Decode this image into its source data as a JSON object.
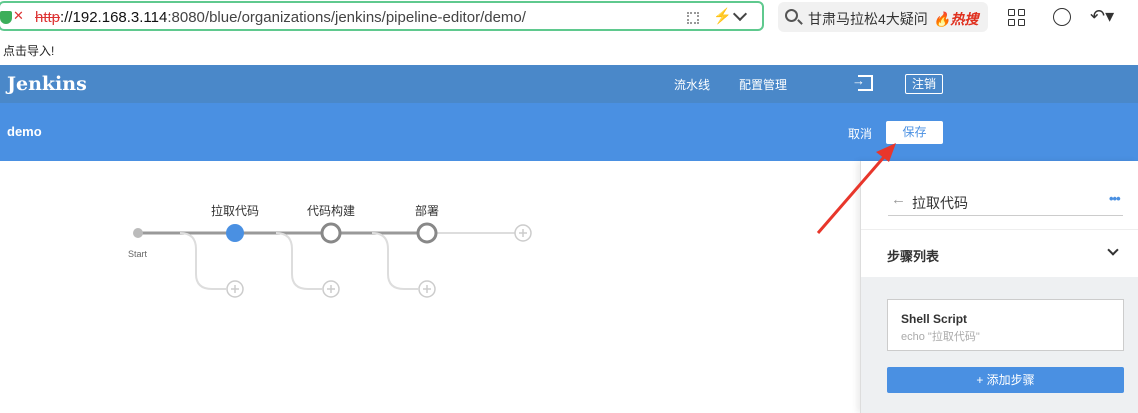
{
  "browser": {
    "url_proto": "http",
    "url_host": "://192.168.3.114",
    "url_rest": ":8080/blue/organizations/jenkins/pipeline-editor/demo/",
    "search_text": "甘肃马拉松4大疑问",
    "hot_label": "🔥热搜",
    "info_line": "点击导入!"
  },
  "header": {
    "logo": "Jenkins",
    "nav": [
      "流水线",
      "配置管理"
    ],
    "logout": "注销"
  },
  "subheader": {
    "pipeline_name": "demo",
    "cancel": "取消",
    "save": "保存"
  },
  "pipeline": {
    "start_label": "Start",
    "stages": [
      {
        "label": "拉取代码",
        "selected": true
      },
      {
        "label": "代码构建",
        "selected": false
      },
      {
        "label": "部署",
        "selected": false
      }
    ]
  },
  "panel": {
    "stage_title": "拉取代码",
    "more": "•••",
    "steps_title": "步骤列表",
    "step": {
      "name": "Shell Script",
      "desc": "echo \"拉取代码\""
    },
    "add_step": "+ 添加步骤"
  },
  "colors": {
    "accent": "#4a90e2",
    "header": "#4a88c9",
    "annotation_arrow": "#e8362b"
  }
}
